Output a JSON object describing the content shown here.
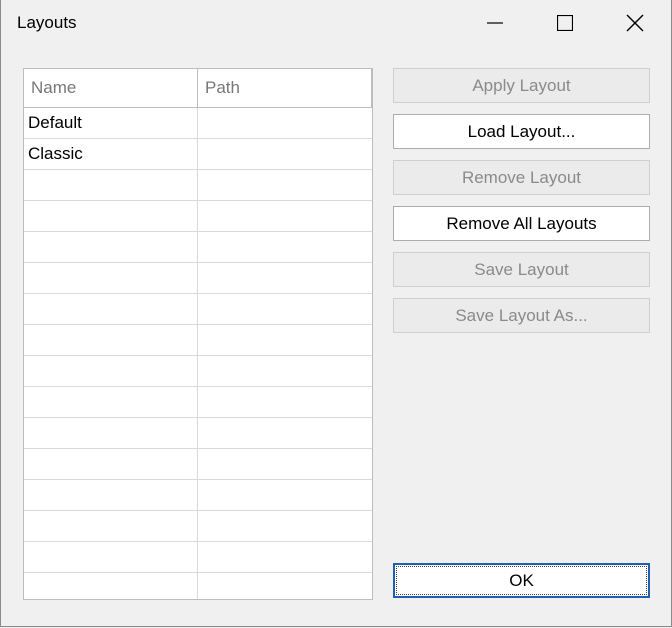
{
  "window": {
    "title": "Layouts"
  },
  "table": {
    "columns": [
      "Name",
      "Path"
    ],
    "rows": [
      {
        "name": "Default",
        "path": ""
      },
      {
        "name": "Classic",
        "path": ""
      },
      {
        "name": "",
        "path": ""
      },
      {
        "name": "",
        "path": ""
      },
      {
        "name": "",
        "path": ""
      },
      {
        "name": "",
        "path": ""
      },
      {
        "name": "",
        "path": ""
      },
      {
        "name": "",
        "path": ""
      },
      {
        "name": "",
        "path": ""
      },
      {
        "name": "",
        "path": ""
      },
      {
        "name": "",
        "path": ""
      },
      {
        "name": "",
        "path": ""
      },
      {
        "name": "",
        "path": ""
      },
      {
        "name": "",
        "path": ""
      },
      {
        "name": "",
        "path": ""
      },
      {
        "name": "",
        "path": ""
      }
    ]
  },
  "buttons": {
    "apply": "Apply Layout",
    "load": "Load Layout...",
    "remove": "Remove Layout",
    "remove_all": "Remove All Layouts",
    "save": "Save Layout",
    "save_as": "Save Layout As...",
    "ok": "OK"
  },
  "icons": {
    "minimize": "minimize-icon",
    "maximize": "maximize-icon",
    "close": "close-icon"
  },
  "colors": {
    "background": "#f0f0f0",
    "default_button_border": "#1f5fb0",
    "disabled_text": "#8a8a8a"
  }
}
